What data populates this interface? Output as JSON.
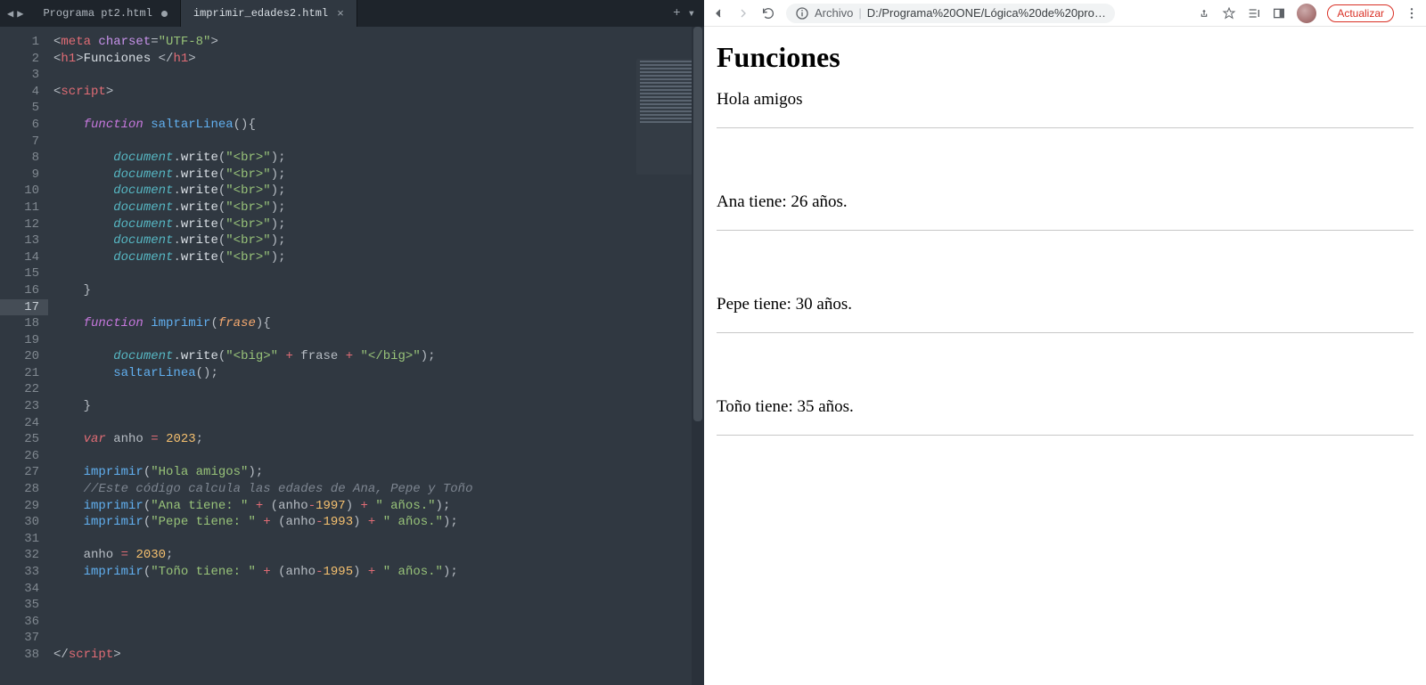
{
  "editor": {
    "nav_prev": "◀",
    "nav_next": "▶",
    "tabs": [
      {
        "label": "Programa pt2.html",
        "modified": true,
        "active": false
      },
      {
        "label": "imprimir_edades2.html",
        "modified": false,
        "active": true
      }
    ],
    "tab_add": "+",
    "tab_more": "▾",
    "active_line": 17,
    "code_lines": [
      {
        "n": 1,
        "tokens": [
          [
            "punc",
            "<"
          ],
          [
            "tag",
            "meta"
          ],
          [
            "punc",
            " "
          ],
          [
            "attr",
            "charset"
          ],
          [
            "punc",
            "="
          ],
          [
            "str",
            "\"UTF-8\""
          ],
          [
            "punc",
            ">"
          ]
        ]
      },
      {
        "n": 2,
        "tokens": [
          [
            "punc",
            "<"
          ],
          [
            "tag",
            "h1"
          ],
          [
            "punc",
            ">"
          ],
          [
            "method",
            "Funciones "
          ],
          [
            "punc",
            "</"
          ],
          [
            "tag",
            "h1"
          ],
          [
            "punc",
            ">"
          ]
        ]
      },
      {
        "n": 3,
        "tokens": []
      },
      {
        "n": 4,
        "tokens": [
          [
            "punc",
            "<"
          ],
          [
            "tag",
            "script"
          ],
          [
            "punc",
            ">"
          ]
        ]
      },
      {
        "n": 5,
        "tokens": []
      },
      {
        "n": 6,
        "tokens": [
          [
            "punc",
            "    "
          ],
          [
            "kw",
            "function"
          ],
          [
            "punc",
            " "
          ],
          [
            "fnname",
            "saltarLinea"
          ],
          [
            "punc",
            "(){"
          ]
        ]
      },
      {
        "n": 7,
        "tokens": []
      },
      {
        "n": 8,
        "tokens": [
          [
            "punc",
            "        "
          ],
          [
            "obj",
            "document"
          ],
          [
            "punc",
            "."
          ],
          [
            "method",
            "write"
          ],
          [
            "punc",
            "("
          ],
          [
            "str",
            "\"<br>\""
          ],
          [
            "punc",
            ");"
          ]
        ]
      },
      {
        "n": 9,
        "tokens": [
          [
            "punc",
            "        "
          ],
          [
            "obj",
            "document"
          ],
          [
            "punc",
            "."
          ],
          [
            "method",
            "write"
          ],
          [
            "punc",
            "("
          ],
          [
            "str",
            "\"<br>\""
          ],
          [
            "punc",
            ");"
          ]
        ]
      },
      {
        "n": 10,
        "tokens": [
          [
            "punc",
            "        "
          ],
          [
            "obj",
            "document"
          ],
          [
            "punc",
            "."
          ],
          [
            "method",
            "write"
          ],
          [
            "punc",
            "("
          ],
          [
            "str",
            "\"<br>\""
          ],
          [
            "punc",
            ");"
          ]
        ]
      },
      {
        "n": 11,
        "tokens": [
          [
            "punc",
            "        "
          ],
          [
            "obj",
            "document"
          ],
          [
            "punc",
            "."
          ],
          [
            "method",
            "write"
          ],
          [
            "punc",
            "("
          ],
          [
            "str",
            "\"<br>\""
          ],
          [
            "punc",
            ");"
          ]
        ]
      },
      {
        "n": 12,
        "tokens": [
          [
            "punc",
            "        "
          ],
          [
            "obj",
            "document"
          ],
          [
            "punc",
            "."
          ],
          [
            "method",
            "write"
          ],
          [
            "punc",
            "("
          ],
          [
            "str",
            "\"<br>\""
          ],
          [
            "punc",
            ");"
          ]
        ]
      },
      {
        "n": 13,
        "tokens": [
          [
            "punc",
            "        "
          ],
          [
            "obj",
            "document"
          ],
          [
            "punc",
            "."
          ],
          [
            "method",
            "write"
          ],
          [
            "punc",
            "("
          ],
          [
            "str",
            "\"<br>\""
          ],
          [
            "punc",
            ");"
          ]
        ]
      },
      {
        "n": 14,
        "tokens": [
          [
            "punc",
            "        "
          ],
          [
            "obj",
            "document"
          ],
          [
            "punc",
            "."
          ],
          [
            "method",
            "write"
          ],
          [
            "punc",
            "("
          ],
          [
            "str",
            "\"<br>\""
          ],
          [
            "punc",
            ");"
          ]
        ]
      },
      {
        "n": 15,
        "tokens": []
      },
      {
        "n": 16,
        "tokens": [
          [
            "punc",
            "    }"
          ]
        ]
      },
      {
        "n": 17,
        "tokens": []
      },
      {
        "n": 18,
        "tokens": [
          [
            "punc",
            "    "
          ],
          [
            "kw",
            "function"
          ],
          [
            "punc",
            " "
          ],
          [
            "fnname",
            "imprimir"
          ],
          [
            "punc",
            "("
          ],
          [
            "param",
            "frase"
          ],
          [
            "punc",
            "){"
          ]
        ]
      },
      {
        "n": 19,
        "tokens": []
      },
      {
        "n": 20,
        "tokens": [
          [
            "punc",
            "        "
          ],
          [
            "obj",
            "document"
          ],
          [
            "punc",
            "."
          ],
          [
            "method",
            "write"
          ],
          [
            "punc",
            "("
          ],
          [
            "str",
            "\"<big>\""
          ],
          [
            "punc",
            " "
          ],
          [
            "op",
            "+"
          ],
          [
            "punc",
            " frase "
          ],
          [
            "op",
            "+"
          ],
          [
            "punc",
            " "
          ],
          [
            "str",
            "\"</big>\""
          ],
          [
            "punc",
            ");"
          ]
        ]
      },
      {
        "n": 21,
        "tokens": [
          [
            "punc",
            "        "
          ],
          [
            "fnname",
            "saltarLinea"
          ],
          [
            "punc",
            "();"
          ]
        ]
      },
      {
        "n": 22,
        "tokens": []
      },
      {
        "n": 23,
        "tokens": [
          [
            "punc",
            "    }"
          ]
        ]
      },
      {
        "n": 24,
        "tokens": []
      },
      {
        "n": 25,
        "tokens": [
          [
            "punc",
            "    "
          ],
          [
            "kw2",
            "var"
          ],
          [
            "punc",
            " anho "
          ],
          [
            "op",
            "="
          ],
          [
            "punc",
            " "
          ],
          [
            "num",
            "2023"
          ],
          [
            "punc",
            ";"
          ]
        ]
      },
      {
        "n": 26,
        "tokens": []
      },
      {
        "n": 27,
        "tokens": [
          [
            "punc",
            "    "
          ],
          [
            "fnname",
            "imprimir"
          ],
          [
            "punc",
            "("
          ],
          [
            "str",
            "\"Hola amigos\""
          ],
          [
            "punc",
            ");"
          ]
        ]
      },
      {
        "n": 28,
        "tokens": [
          [
            "punc",
            "    "
          ],
          [
            "cmt",
            "//Este código calcula las edades de Ana, Pepe y Toño"
          ]
        ]
      },
      {
        "n": 29,
        "tokens": [
          [
            "punc",
            "    "
          ],
          [
            "fnname",
            "imprimir"
          ],
          [
            "punc",
            "("
          ],
          [
            "str",
            "\"Ana tiene: \""
          ],
          [
            "punc",
            " "
          ],
          [
            "op",
            "+"
          ],
          [
            "punc",
            " (anho"
          ],
          [
            "op",
            "-"
          ],
          [
            "num",
            "1997"
          ],
          [
            "punc",
            ") "
          ],
          [
            "op",
            "+"
          ],
          [
            "punc",
            " "
          ],
          [
            "str",
            "\" años.\""
          ],
          [
            "punc",
            ");"
          ]
        ]
      },
      {
        "n": 30,
        "tokens": [
          [
            "punc",
            "    "
          ],
          [
            "fnname",
            "imprimir"
          ],
          [
            "punc",
            "("
          ],
          [
            "str",
            "\"Pepe tiene: \""
          ],
          [
            "punc",
            " "
          ],
          [
            "op",
            "+"
          ],
          [
            "punc",
            " (anho"
          ],
          [
            "op",
            "-"
          ],
          [
            "num",
            "1993"
          ],
          [
            "punc",
            ") "
          ],
          [
            "op",
            "+"
          ],
          [
            "punc",
            " "
          ],
          [
            "str",
            "\" años.\""
          ],
          [
            "punc",
            ");"
          ]
        ]
      },
      {
        "n": 31,
        "tokens": []
      },
      {
        "n": 32,
        "tokens": [
          [
            "punc",
            "    anho "
          ],
          [
            "op",
            "="
          ],
          [
            "punc",
            " "
          ],
          [
            "num",
            "2030"
          ],
          [
            "punc",
            ";"
          ]
        ]
      },
      {
        "n": 33,
        "tokens": [
          [
            "punc",
            "    "
          ],
          [
            "fnname",
            "imprimir"
          ],
          [
            "punc",
            "("
          ],
          [
            "str",
            "\"Toño tiene: \""
          ],
          [
            "punc",
            " "
          ],
          [
            "op",
            "+"
          ],
          [
            "punc",
            " (anho"
          ],
          [
            "op",
            "-"
          ],
          [
            "num",
            "1995"
          ],
          [
            "punc",
            ") "
          ],
          [
            "op",
            "+"
          ],
          [
            "punc",
            " "
          ],
          [
            "str",
            "\" años.\""
          ],
          [
            "punc",
            ");"
          ]
        ]
      },
      {
        "n": 34,
        "tokens": []
      },
      {
        "n": 35,
        "tokens": []
      },
      {
        "n": 36,
        "tokens": []
      },
      {
        "n": 37,
        "tokens": []
      },
      {
        "n": 38,
        "tokens": [
          [
            "punc",
            "</"
          ],
          [
            "tag",
            "script"
          ],
          [
            "punc",
            ">"
          ]
        ]
      }
    ]
  },
  "browser": {
    "toolbar": {
      "addr_label": "Archivo",
      "addr_text": "D:/Programa%20ONE/Lógica%20de%20pro…",
      "actualizar": "Actualizar"
    },
    "page": {
      "heading": "Funciones",
      "lines": [
        "Hola amigos",
        "Ana tiene: 26 años.",
        "Pepe tiene: 30 años.",
        "Toño tiene: 35 años."
      ]
    }
  }
}
